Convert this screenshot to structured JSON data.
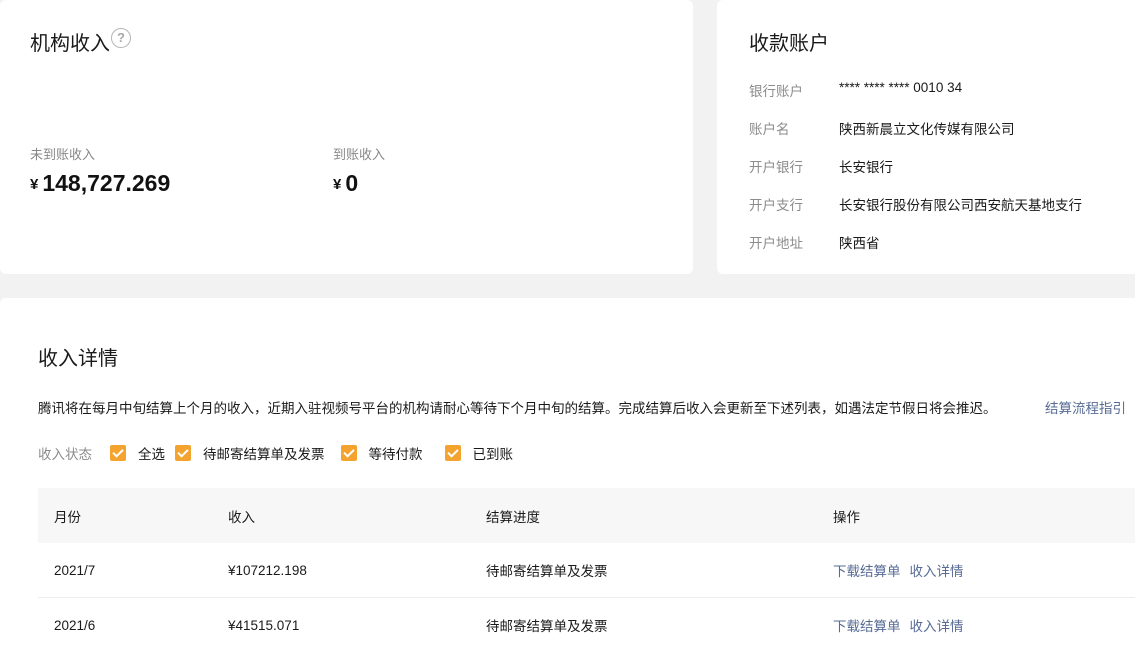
{
  "income": {
    "title": "机构收入",
    "help_icon": "?",
    "pending": {
      "label": "未到账收入",
      "currency": "¥",
      "amount": "148,727.269"
    },
    "received": {
      "label": "到账收入",
      "currency": "¥",
      "amount": "0"
    }
  },
  "account": {
    "title": "收款账户",
    "rows": [
      {
        "label": "银行账户",
        "value": "**** **** **** 0010 34"
      },
      {
        "label": "账户名",
        "value": "陕西新晨立文化传媒有限公司"
      },
      {
        "label": "开户银行",
        "value": "长安银行"
      },
      {
        "label": "开户支行",
        "value": "长安银行股份有限公司西安航天基地支行"
      },
      {
        "label": "开户地址",
        "value": "陕西省"
      }
    ]
  },
  "detail": {
    "title": "收入详情",
    "notice": "腾讯将在每月中旬结算上个月的收入，近期入驻视频号平台的机构请耐心等待下个月中旬的结算。完成结算后收入会更新至下述列表，如遇法定节假日将会推迟。",
    "guide_link": "结算流程指引",
    "filter": {
      "label": "收入状态",
      "options": [
        {
          "label": "全选",
          "checked": true
        },
        {
          "label": "待邮寄结算单及发票",
          "checked": true
        },
        {
          "label": "等待付款",
          "checked": true
        },
        {
          "label": "已到账",
          "checked": true
        }
      ]
    },
    "table": {
      "headers": [
        "月份",
        "收入",
        "结算进度",
        "操作"
      ],
      "rows": [
        {
          "month": "2021/7",
          "income": "¥107212.198",
          "status": "待邮寄结算单及发票",
          "action_download": "下载结算单",
          "action_detail": "收入详情"
        },
        {
          "month": "2021/6",
          "income": "¥41515.071",
          "status": "待邮寄结算单及发票",
          "action_download": "下载结算单",
          "action_detail": "收入详情"
        }
      ]
    }
  },
  "colors": {
    "accent_checkbox": "#f4a32f",
    "link": "#576b95",
    "background": "#f2f2f2"
  }
}
